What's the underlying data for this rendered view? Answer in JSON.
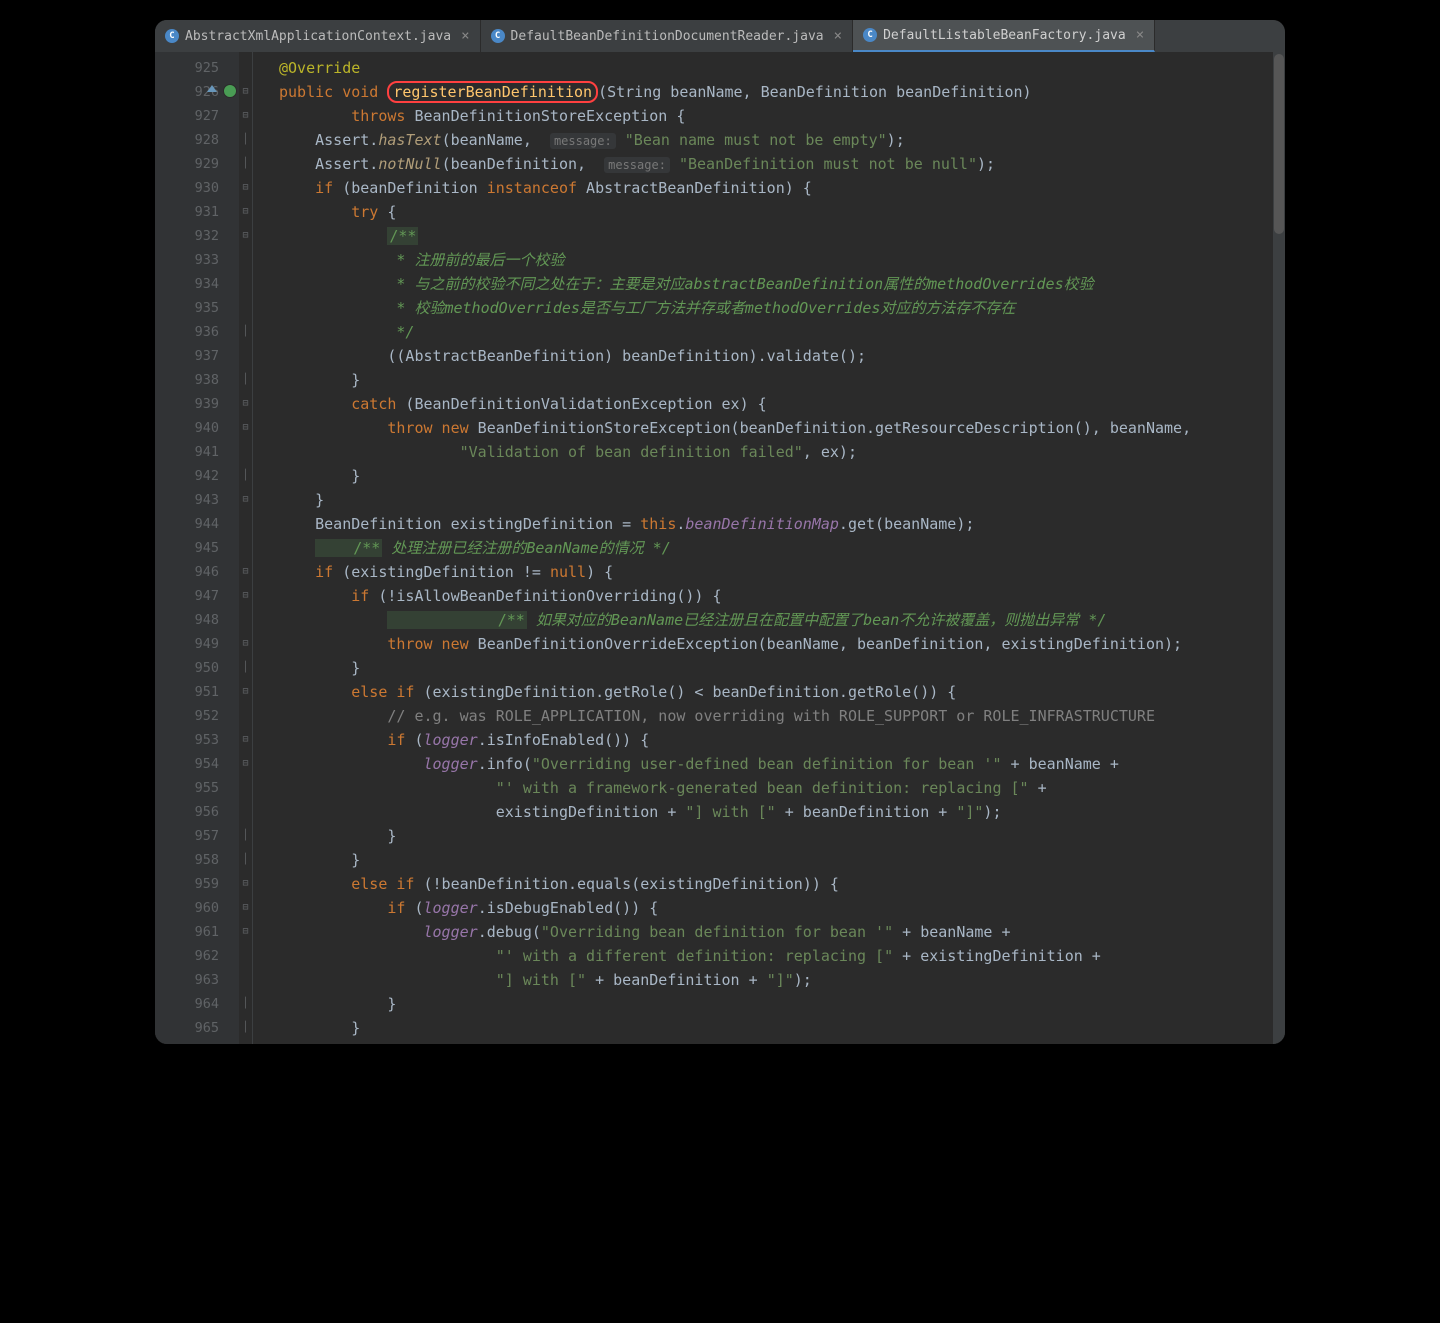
{
  "tabs": [
    {
      "label": "AbstractXmlApplicationContext.java",
      "active": false
    },
    {
      "label": "DefaultBeanDefinitionDocumentReader.java",
      "active": false
    },
    {
      "label": "DefaultListableBeanFactory.java",
      "active": true
    }
  ],
  "startLine": 925,
  "highlight": {
    "line": 926,
    "text": "registerBeanDefinition"
  },
  "hints": {
    "hasTextMsg": "message:",
    "hasTextMsgVal": "\"Bean name must not be empty\"",
    "notNullMsg": "message:",
    "notNullMsgVal": "\"BeanDefinition must not be null\""
  },
  "code": {
    "l925": "@Override",
    "l926_pre": "public void ",
    "l926_post": "(String beanName, BeanDefinition beanDefinition)",
    "l927": "        throws BeanDefinitionStoreException {",
    "l928_a": "    Assert.",
    "l928_b": "hasText",
    "l928_c": "(beanName, ",
    "l928_d": ");",
    "l929_a": "    Assert.",
    "l929_b": "notNull",
    "l929_c": "(beanDefinition, ",
    "l929_d": ");",
    "l930": "    if (beanDefinition instanceof AbstractBeanDefinition) {",
    "l931": "        try {",
    "l932": "            /**",
    "l933": "             * 注册前的最后一个校验",
    "l934": "             * 与之前的校验不同之处在于：主要是对应abstractBeanDefinition属性的methodOverrides校验",
    "l935": "             * 校验methodOverrides是否与工厂方法并存或者methodOverrides对应的方法存不存在",
    "l936": "             */",
    "l937": "            ((AbstractBeanDefinition) beanDefinition).validate();",
    "l938": "        }",
    "l939": "        catch (BeanDefinitionValidationException ex) {",
    "l940": "            throw new BeanDefinitionStoreException(beanDefinition.getResourceDescription(), beanName,",
    "l941": "                    \"Validation of bean definition failed\", ex);",
    "l942": "        }",
    "l943": "    }",
    "l944": "    BeanDefinition existingDefinition = this.beanDefinitionMap.get(beanName);",
    "l945_a": "    /**",
    "l945_b": " 处理注册已经注册的",
    "l945_c": "BeanName",
    "l945_d": "的情况 */",
    "l946": "    if (existingDefinition != null) {",
    "l947": "        if (!isAllowBeanDefinitionOverriding()) {",
    "l948_a": "            /**",
    "l948_b": " 如果对应的",
    "l948_c": "BeanName",
    "l948_d": "已经注册且在配置中配置了",
    "l948_e": "bean",
    "l948_f": "不允许被覆盖，则抛出异常 */",
    "l949": "            throw new BeanDefinitionOverrideException(beanName, beanDefinition, existingDefinition);",
    "l950": "        }",
    "l951": "        else if (existingDefinition.getRole() < beanDefinition.getRole()) {",
    "l952": "            // e.g. was ROLE_APPLICATION, now overriding with ROLE_SUPPORT or ROLE_INFRASTRUCTURE",
    "l953": "            if (logger.isInfoEnabled()) {",
    "l954": "                logger.info(\"Overriding user-defined bean definition for bean '\" + beanName +",
    "l955": "                        \"' with a framework-generated bean definition: replacing [\" +",
    "l956": "                        existingDefinition + \"] with [\" + beanDefinition + \"]\");",
    "l957": "            }",
    "l958": "        }",
    "l959": "        else if (!beanDefinition.equals(existingDefinition)) {",
    "l960": "            if (logger.isDebugEnabled()) {",
    "l961": "                logger.debug(\"Overriding bean definition for bean '\" + beanName +",
    "l962": "                        \"' with a different definition: replacing [\" + existingDefinition +",
    "l963": "                        \"] with [\" + beanDefinition + \"]\");",
    "l964": "            }",
    "l965": "        }"
  }
}
